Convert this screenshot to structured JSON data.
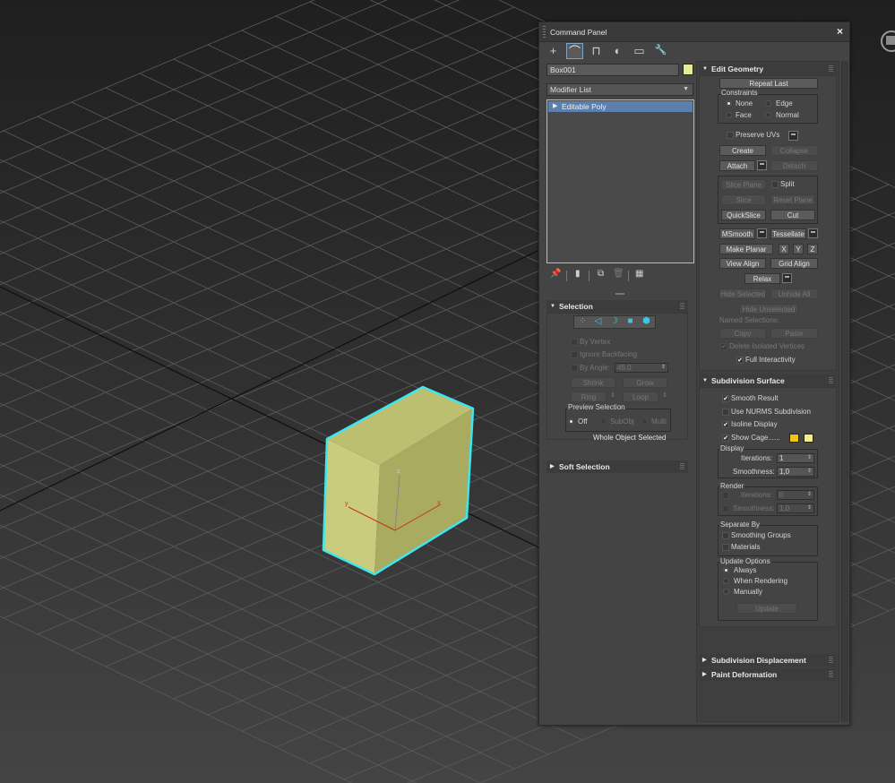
{
  "panel": {
    "title": "Command Panel",
    "close_label": "×",
    "tabs": [
      {
        "icon": "create-icon",
        "glyph": "+"
      },
      {
        "icon": "modify-icon",
        "glyph": "⌒"
      },
      {
        "icon": "hierarchy-icon",
        "glyph": "⊓"
      },
      {
        "icon": "motion-icon",
        "glyph": "◐"
      },
      {
        "icon": "display-icon",
        "glyph": "▭"
      },
      {
        "icon": "utilities-icon",
        "glyph": "🔧"
      }
    ],
    "object_name": "Box001",
    "object_color": "#e6e89a",
    "modifier_list": "Modifier List",
    "stack_item": "Editable Poly"
  },
  "selection": {
    "header": "Selection",
    "by_vertex": "By Vertex",
    "ignore_backfacing": "Ignore Backfacing",
    "by_angle": "By Angle:",
    "angle_value": "45,0",
    "shrink": "Shrink",
    "grow": "Grow",
    "ring": "Ring",
    "loop": "Loop",
    "preview_selection": "Preview Selection",
    "off": "Off",
    "subobj": "SubObj",
    "multi": "Multi",
    "status": "Whole Object Selected"
  },
  "soft_selection": {
    "header": "Soft Selection"
  },
  "edit_geometry": {
    "header": "Edit Geometry",
    "repeat_last": "Repeat Last",
    "constraints": "Constraints",
    "none": "None",
    "edge": "Edge",
    "face": "Face",
    "normal": "Normal",
    "preserve_uvs": "Preserve UVs",
    "create": "Create",
    "collapse": "Collapse",
    "attach": "Attach",
    "detach": "Detach",
    "slice_plane": "Slice Plane",
    "split": "Split",
    "slice": "Slice",
    "reset_plane": "Reset Plane",
    "quickslice": "QuickSlice",
    "cut": "Cut",
    "msmooth": "MSmooth",
    "tessellate": "Tessellate",
    "make_planar": "Make Planar",
    "x": "X",
    "y": "Y",
    "z": "Z",
    "view_align": "View Align",
    "grid_align": "Grid Align",
    "relax": "Relax",
    "hide_selected": "Hide Selected",
    "unhide_all": "Unhide All",
    "hide_unselected": "Hide Unselected",
    "named_selections": "Named Selections:",
    "copy": "Copy",
    "paste": "Paste",
    "delete_isolated": "Delete Isolated Vertices",
    "full_interactivity": "Full Interactivity"
  },
  "subdivision": {
    "header": "Subdivision Surface",
    "smooth_result": "Smooth Result",
    "use_nurms": "Use NURMS Subdivision",
    "isoline_display": "Isoline Display",
    "show_cage": "Show Cage......",
    "cage_color_1": "#f0c21a",
    "cage_color_2": "#f0f08a",
    "display": "Display",
    "iterations": "Iterations:",
    "iterations_value": "1",
    "smoothness": "Smoothness:",
    "smoothness_value": "1,0",
    "render": "Render",
    "render_iterations": "Iterations:",
    "render_iterations_value": "0",
    "render_smoothness": "Smoothness:",
    "render_smoothness_value": "1,0",
    "separate_by": "Separate By",
    "smoothing_groups": "Smoothing Groups",
    "materials": "Materials",
    "update_options": "Update Options",
    "always": "Always",
    "when_rendering": "When Rendering",
    "manually": "Manually",
    "update": "Update"
  },
  "subdivision_displacement": {
    "header": "Subdivision Displacement"
  },
  "paint_deformation": {
    "header": "Paint Deformation"
  },
  "viewport": {
    "object_color": "#c9cc7c",
    "selection_outline": "#3ee6ef",
    "gizmo_x": "x",
    "gizmo_y": "y",
    "gizmo_z": "z"
  }
}
